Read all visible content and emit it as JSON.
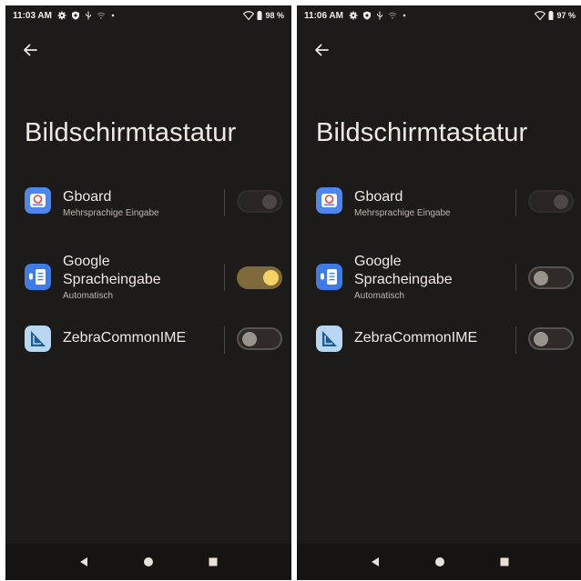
{
  "screens": [
    {
      "status": {
        "time": "11:03 AM",
        "battery": "98 %"
      },
      "title": "Bildschirmtastatur",
      "keyboards": [
        {
          "name": "Gboard",
          "subtitle": "Mehrsprachige Eingabe",
          "toggle": "disabled-on"
        },
        {
          "name": "Google\nSpracheingabe",
          "subtitle": "Automatisch",
          "toggle": "on"
        },
        {
          "name": "ZebraCommonIME",
          "subtitle": "",
          "toggle": "off"
        }
      ]
    },
    {
      "status": {
        "time": "11:06 AM",
        "battery": "97 %"
      },
      "title": "Bildschirmtastatur",
      "keyboards": [
        {
          "name": "Gboard",
          "subtitle": "Mehrsprachige Eingabe",
          "toggle": "disabled-on"
        },
        {
          "name": "Google\nSpracheingabe",
          "subtitle": "Automatisch",
          "toggle": "off"
        },
        {
          "name": "ZebraCommonIME",
          "subtitle": "",
          "toggle": "off"
        }
      ]
    }
  ],
  "icons": {
    "back": "arrow-left-icon",
    "status": [
      "settings-gear-icon",
      "shield-icon",
      "usb-icon",
      "signal-off-icon",
      "dot-icon"
    ],
    "wifi": "wifi-icon",
    "battery": "battery-icon",
    "apps": [
      "gboard-icon",
      "voice-typing-icon",
      "zebra-ime-icon"
    ],
    "nav": [
      "nav-back-icon",
      "nav-home-icon",
      "nav-recents-icon"
    ]
  },
  "colors": {
    "background": "#1d1b19",
    "toggle_on_track": "#7f6a3b",
    "toggle_on_knob": "#f6d165"
  }
}
